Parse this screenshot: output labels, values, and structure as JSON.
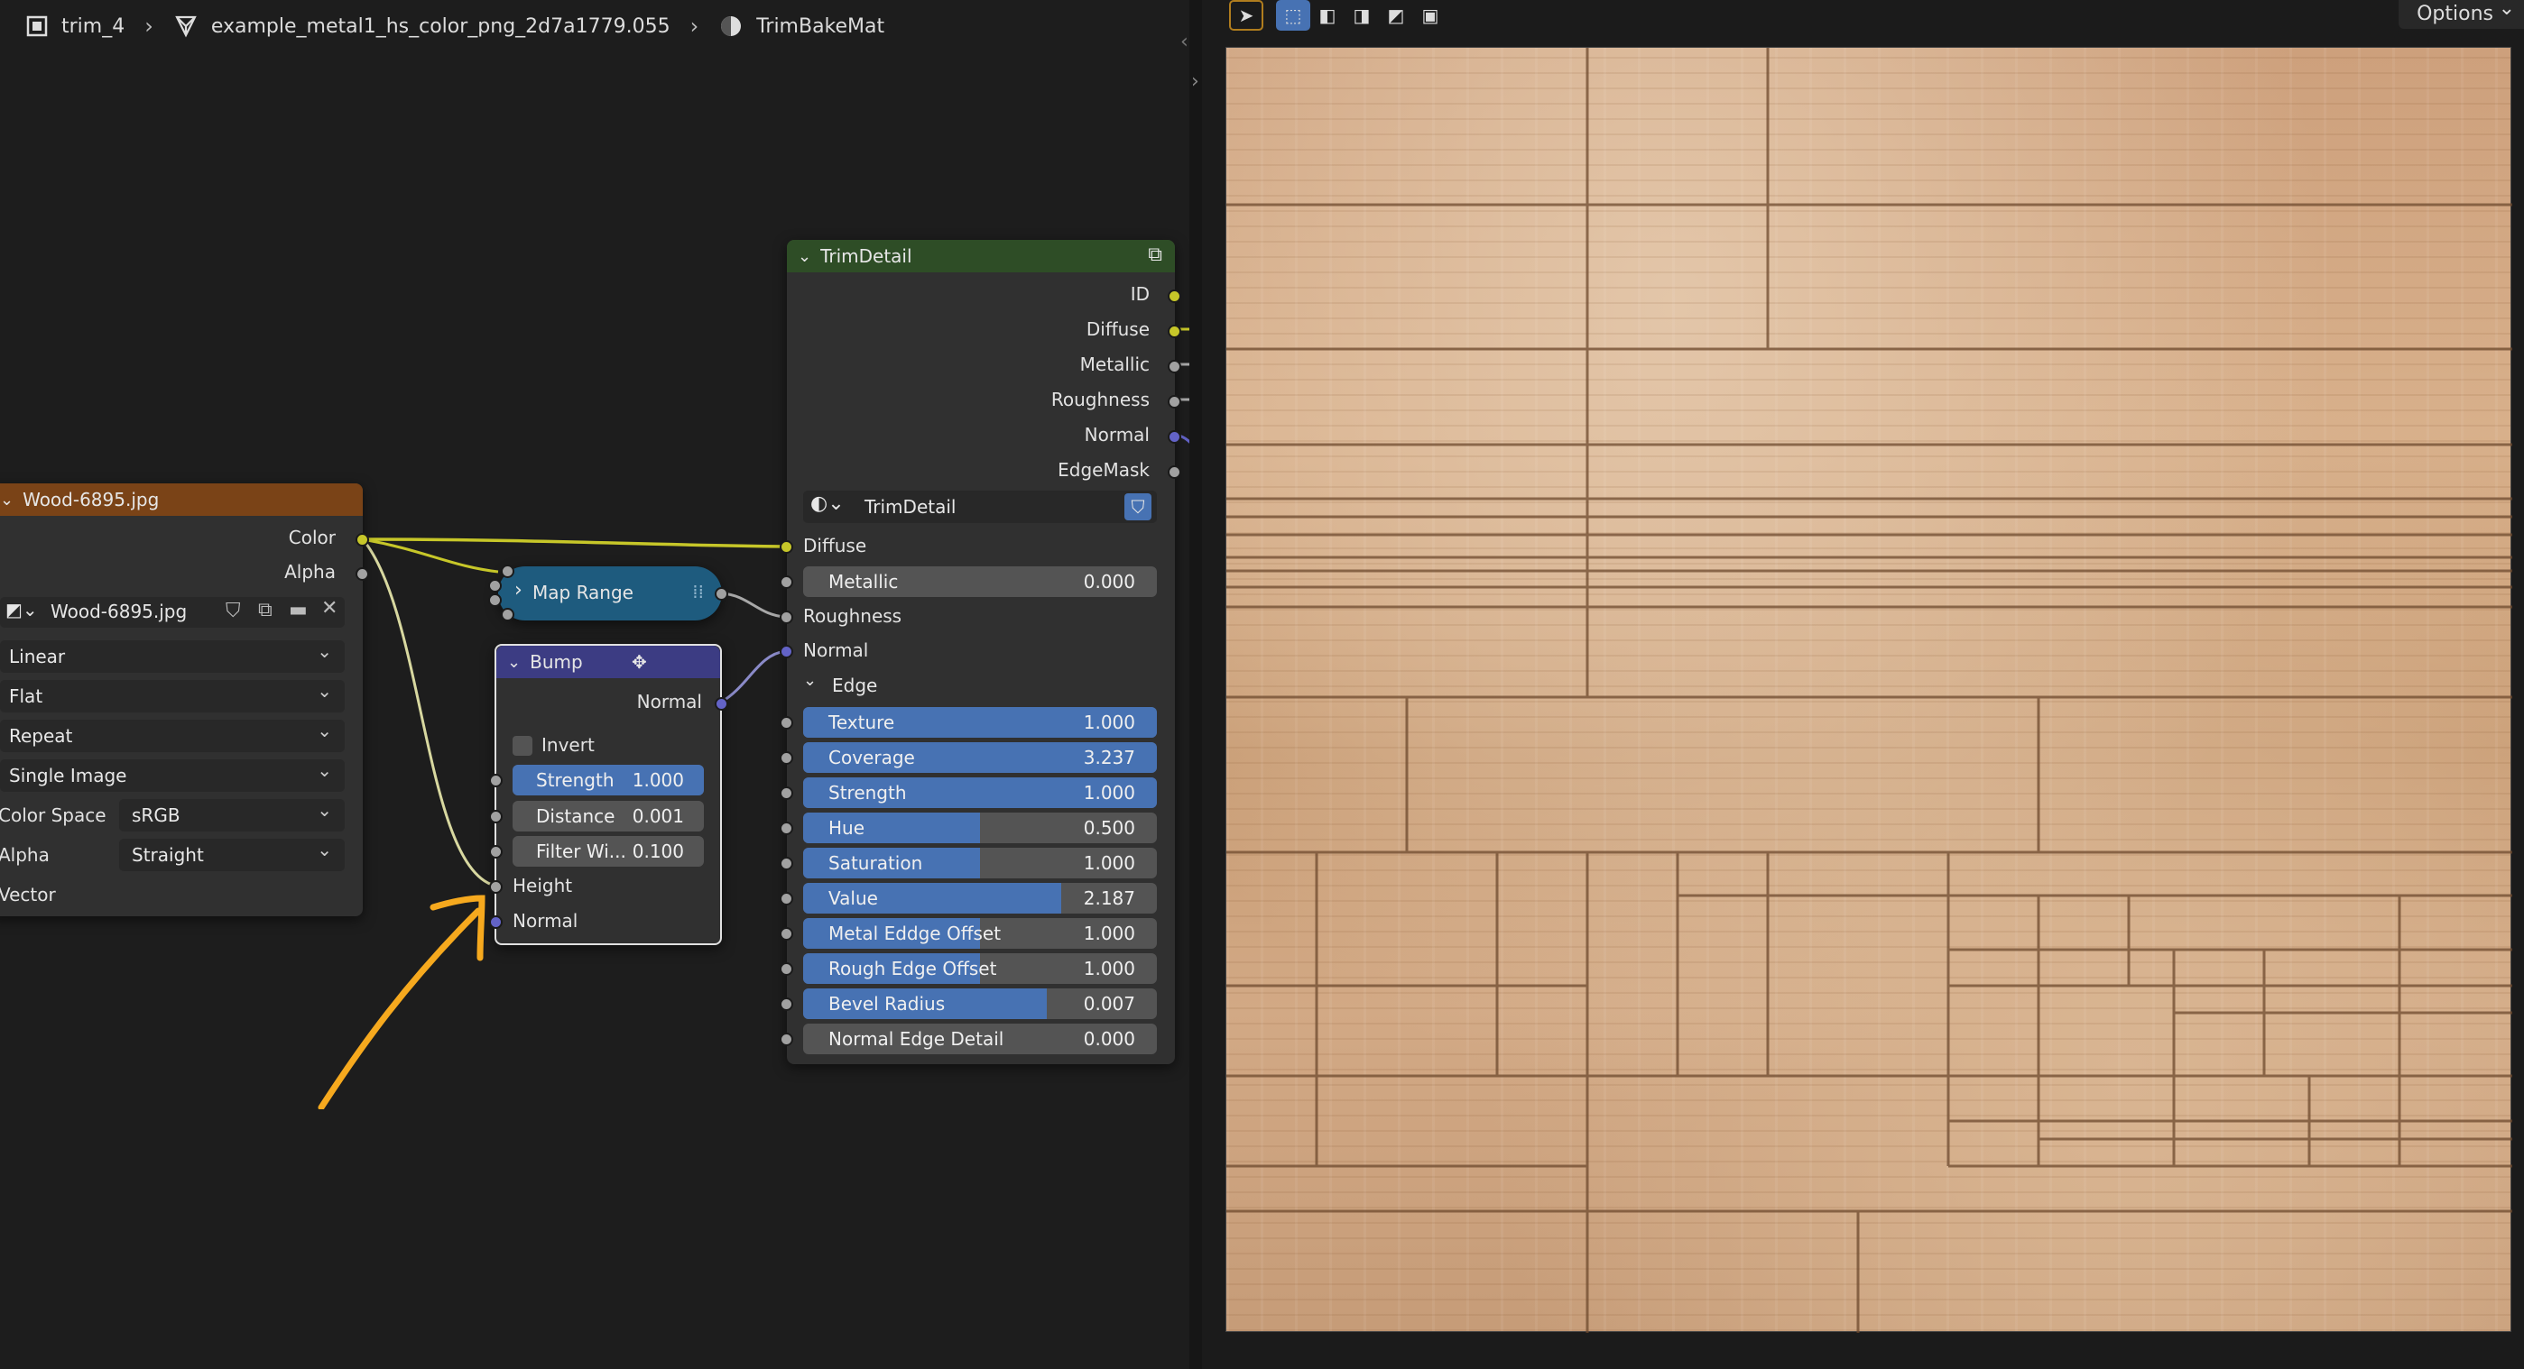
{
  "breadcrumb": {
    "object": "trim_4",
    "mesh": "example_metal1_hs_color_png_2d7a1779.055",
    "material": "TrimBakeMat",
    "object_icon": "object-icon",
    "mesh_icon": "mesh-icon",
    "material_icon": "material-icon"
  },
  "image_node": {
    "title": "Wood-6895.jpg",
    "header_color": "#7a4317",
    "outputs": [
      "Color",
      "Alpha"
    ],
    "image_name": "Wood-6895.jpg",
    "interpolation": "Linear",
    "projection": "Flat",
    "extension": "Repeat",
    "source": "Single Image",
    "color_space_label": "Color Space",
    "color_space": "sRGB",
    "alpha_label": "Alpha",
    "alpha_value": "Straight",
    "vector_label": "Vector"
  },
  "map_range_node": {
    "title": "Map Range",
    "color": "#1e5b7e"
  },
  "bump_node": {
    "title": "Bump",
    "header_color": "#3c3c83",
    "output": "Normal",
    "invert_label": "Invert",
    "invert_checked": false,
    "strength_label": "Strength",
    "strength_value": "1.000",
    "distance_label": "Distance",
    "distance_value": "0.001",
    "filter_label": "Filter Wi...",
    "filter_value": "0.100",
    "height_label": "Height",
    "normal_label": "Normal"
  },
  "trim_node": {
    "title": "TrimDetail",
    "header_color": "#2e4d26",
    "outputs": [
      "ID",
      "Diffuse",
      "Metallic",
      "Roughness",
      "Normal",
      "EdgeMask"
    ],
    "group_name": "TrimDetail",
    "inputs": {
      "diffuse": "Diffuse",
      "metallic_label": "Metallic",
      "metallic_value": "0.000",
      "roughness": "Roughness",
      "normal": "Normal"
    },
    "panel_label": "Edge",
    "edge_fields": [
      {
        "label": "Texture",
        "value": "1.000",
        "fill": 1.0
      },
      {
        "label": "Coverage",
        "value": "3.237",
        "fill": 1.0
      },
      {
        "label": "Strength",
        "value": "1.000",
        "fill": 1.0
      },
      {
        "label": "Hue",
        "value": "0.500",
        "fill": 0.5
      },
      {
        "label": "Saturation",
        "value": "1.000",
        "fill": 0.5
      },
      {
        "label": "Value",
        "value": "2.187",
        "fill": 0.73
      },
      {
        "label": "Metal Eddge Offset",
        "value": "1.000",
        "fill": 0.5
      },
      {
        "label": "Rough Edge Offset",
        "value": "1.000",
        "fill": 0.5
      },
      {
        "label": "Bevel Radius",
        "value": "0.007",
        "fill": 0.69
      },
      {
        "label": "Normal Edge Detail",
        "value": "0.000",
        "fill": 0.0
      }
    ]
  },
  "image_editor": {
    "options_label": "Options",
    "texture_name": "wood texture preview"
  },
  "colors": {
    "accent_blue": "#4772b3",
    "socket_yellow": "#c7c729",
    "socket_gray": "#a1a1a1",
    "socket_violet": "#6363c7",
    "annotation_orange": "#f6a91e"
  }
}
